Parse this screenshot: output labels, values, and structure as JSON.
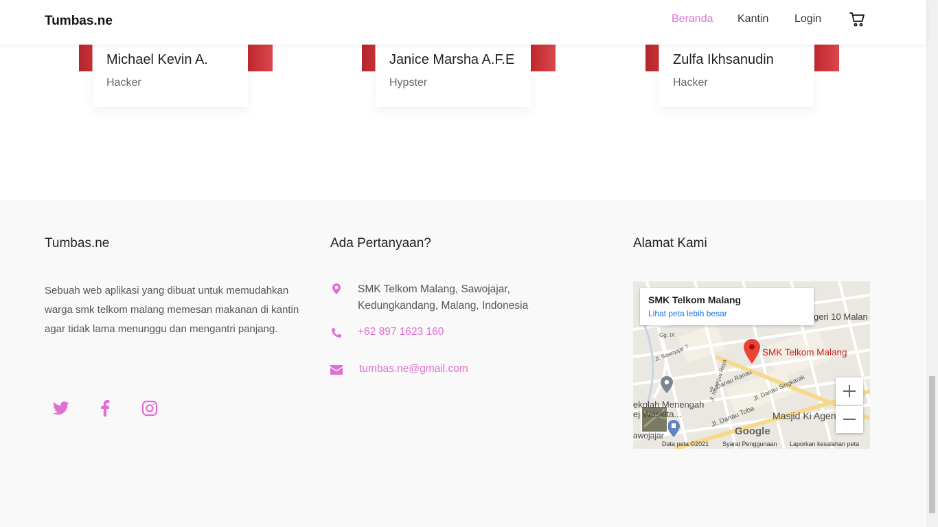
{
  "header": {
    "brand": "Tumbas.ne",
    "nav": [
      "Beranda",
      "Kantin",
      "Login"
    ],
    "active_nav": "Beranda",
    "cart_icon": "cart-icon"
  },
  "team": [
    {
      "name": "Michael Kevin A.",
      "role": "Hacker"
    },
    {
      "name": "Janice Marsha A.F.E",
      "role": "Hypster"
    },
    {
      "name": "Zulfa Ikhsanudin",
      "role": "Hacker"
    }
  ],
  "footer": {
    "about": {
      "title": "Tumbas.ne",
      "description": "Sebuah web aplikasi yang dibuat untuk memudahkan warga smk telkom malang memesan makanan di kantin agar tidak lama menunggu dan mengantri panjang."
    },
    "social": [
      "twitter-icon",
      "facebook-icon",
      "instagram-icon"
    ],
    "contact": {
      "title": "Ada Pertanyaan?",
      "address": "SMK Telkom Malang, Sawojajar, Kedungkandang, Malang, Indonesia",
      "phone": "+62 897 1623 160",
      "email": "tumbas.ne@gmail.com"
    },
    "address_section": {
      "title": "Alamat Kami",
      "map": {
        "place_title": "SMK Telkom Malang",
        "larger_map_link": "Lihat peta lebih besar",
        "pin_label": "SMK Telkom Malang",
        "labels": [
          "Jl. Danau Toba",
          "Masjid Ki Ageng",
          "ekolah Menengah",
          "ej Waskita...",
          "awojajar",
          "Jl. Sawojajar 7",
          "Gg. IX",
          "geri 10 Malan",
          "Jl. Danau Singkarak",
          "Jl. Danau Ranau",
          "Jl. Maninjau Raya"
        ],
        "footer": [
          "Data peta ©2021",
          "Syarat Penggunaan",
          "Laporkan kesalahan peta"
        ],
        "logo": "Google"
      }
    }
  },
  "colors": {
    "accent": "#e16ed5",
    "footer_bg": "#f9f9f9",
    "photo_red": "#c0282e"
  }
}
